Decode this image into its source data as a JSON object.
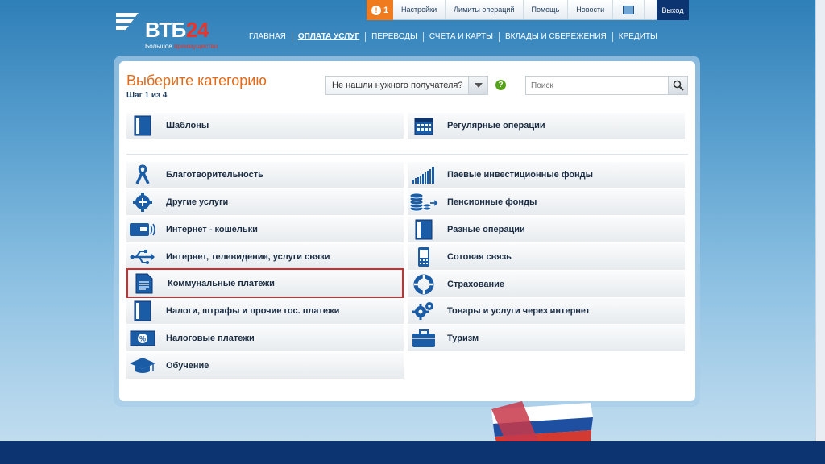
{
  "topbar": {
    "alert_count": "1",
    "links": [
      "Настройки",
      "Лимиты операций",
      "Помощь",
      "Новости"
    ],
    "exit_label": "Выход"
  },
  "logo": {
    "brand_text": "ВТБ",
    "brand_num": "24",
    "tag_plain": "Большое ",
    "tag_red": "преимущество"
  },
  "mainnav": [
    "Главная",
    "Оплата услуг",
    "Переводы",
    "Счета и карты",
    "Вклады и сбережения",
    "Кредиты"
  ],
  "mainnav_active": "Оплата услуг",
  "page": {
    "title": "Выберите категорию",
    "step": "Шаг 1 из 4",
    "recipient_select": "Не нашли нужного получателя?",
    "search_placeholder": "Поиск"
  },
  "top_categories": [
    {
      "label": "Шаблоны",
      "icon": "document-icon"
    },
    {
      "label": "Регулярные операции",
      "icon": "calendar-icon"
    }
  ],
  "left_categories": [
    {
      "label": "Благотворительность",
      "icon": "ribbon-icon"
    },
    {
      "label": "Другие услуги",
      "icon": "gear-plus-icon"
    },
    {
      "label": "Интернет - кошельки",
      "icon": "wallet-icon"
    },
    {
      "label": "Интернет, телевидение, услуги связи",
      "icon": "usb-icon"
    },
    {
      "label": "Коммунальные платежи",
      "icon": "bill-icon"
    },
    {
      "label": "Налоги, штрафы и прочие гос. платежи",
      "icon": "document-icon"
    },
    {
      "label": "Налоговые платежи",
      "icon": "tax-percent-icon"
    },
    {
      "label": "Обучение",
      "icon": "graduation-cap-icon"
    }
  ],
  "right_categories": [
    {
      "label": "Паевые инвестиционные фонды",
      "icon": "bar-chart-icon"
    },
    {
      "label": "Пенсионные фонды",
      "icon": "coin-stack-icon"
    },
    {
      "label": "Разные операции",
      "icon": "document-icon"
    },
    {
      "label": "Сотовая связь",
      "icon": "mobile-phone-icon"
    },
    {
      "label": "Страхование",
      "icon": "lifebuoy-icon"
    },
    {
      "label": "Товары и услуги через интернет",
      "icon": "gears-icon"
    },
    {
      "label": "Туризм",
      "icon": "suitcase-icon"
    }
  ],
  "highlighted_category": "Коммунальные платежи",
  "colors": {
    "accent_orange": "#e06b1a",
    "brand_blue": "#0c3471",
    "highlight_red": "#d22b2b"
  }
}
